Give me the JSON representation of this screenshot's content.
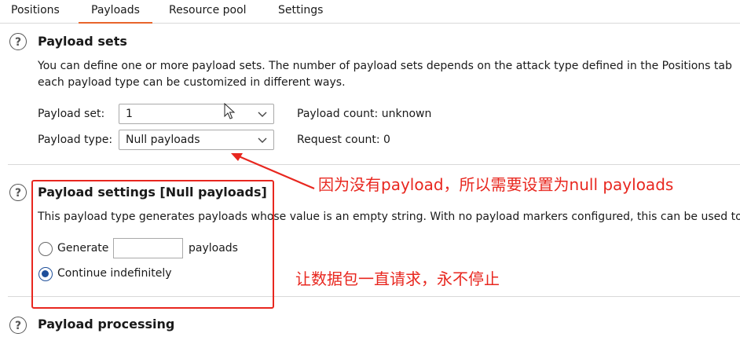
{
  "tabs": [
    "Positions",
    "Payloads",
    "Resource pool",
    "Settings"
  ],
  "payload_sets": {
    "title": "Payload sets",
    "desc_line1": "You can define one or more payload sets. The number of payload sets depends on the attack type defined in the Positions tab",
    "desc_line2": "each payload type can be customized in different ways.",
    "set_label": "Payload set:",
    "set_value": "1",
    "type_label": "Payload type:",
    "type_value": "Null payloads",
    "payload_count": "Payload count: unknown",
    "request_count": "Request count: 0"
  },
  "payload_settings": {
    "title": "Payload settings [Null payloads]",
    "desc": "This payload type generates payloads whose value is an empty string. With no payload markers configured, this can be used to",
    "generate_label": "Generate",
    "generate_value": "",
    "payloads_label": "payloads",
    "continue_label": "Continue indefinitely",
    "selected_option": "Continue indefinitely"
  },
  "payload_processing": {
    "title": "Payload processing"
  },
  "annotations": {
    "note1": "因为没有payload，所以需要设置为null payloads",
    "note2": "让数据包一直请求，永不停止",
    "color": "#e8271f"
  },
  "icons": {
    "help": "question-circle-icon",
    "dropdown": "chevron-down-icon",
    "cursor": "mouse-pointer-icon"
  },
  "colors": {
    "accent_tab": "#e8652b",
    "radio_selected": "#1f4f9a"
  }
}
